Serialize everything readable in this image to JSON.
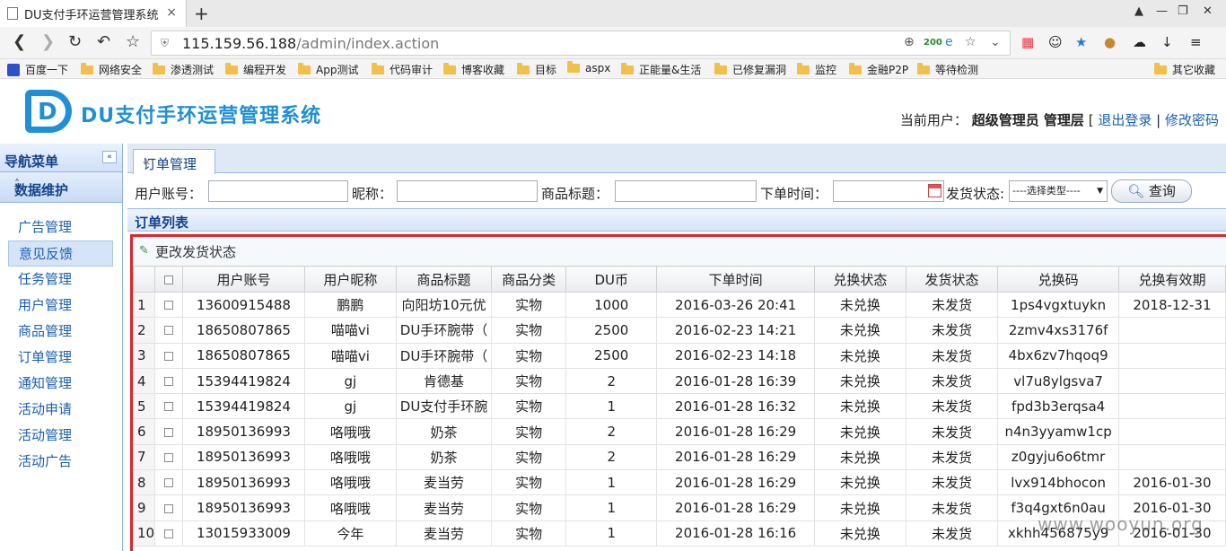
{
  "browser": {
    "tab_title": "DU支付手环运营管理系统",
    "tab_close": "×",
    "new_tab": "+",
    "url_host": "115.159.56.188",
    "url_path": "/admin/index.action",
    "badge_200": "200",
    "bookmarks": [
      "百度一下",
      "网络安全",
      "渗透测试",
      "编程开发",
      "App测试",
      "代码审计",
      "博客收藏",
      "目标",
      "aspx",
      "正能量&生活",
      "已修复漏洞",
      "监控",
      "金融P2P",
      "等待检测"
    ],
    "other_bookmarks": "其它收藏"
  },
  "header": {
    "logo_letter": "D",
    "title": "DU支付手环运营管理系统",
    "current_user_label": "当前用户：",
    "user_name": "超级管理员 管理层",
    "bracket_open": "[",
    "logout": "退出登录",
    "separator": "|",
    "change_password": "修改密码"
  },
  "sidebar": {
    "title": "导航菜单",
    "group": "数据维护",
    "items": [
      "广告管理",
      "意见反馈",
      "任务管理",
      "用户管理",
      "商品管理",
      "订单管理",
      "通知管理",
      "活动申请",
      "活动管理",
      "活动广告"
    ],
    "active_index": 1
  },
  "main": {
    "tab_label": "订单管理",
    "tab_close": "×",
    "search": {
      "account_label": "用户账号：",
      "nickname_label": "昵称：",
      "product_title_label": "商品标题：",
      "order_time_label": "下单时间：",
      "ship_status_label": "发货状态:",
      "select_value": "----选择类型----",
      "query_button": "查询"
    },
    "list_title": "订单列表",
    "toolbar_action": "更改发货状态",
    "columns": [
      "用户账号",
      "用户昵称",
      "商品标题",
      "商品分类",
      "DU币",
      "下单时间",
      "兑换状态",
      "发货状态",
      "兑换码",
      "兑换有效期"
    ],
    "rows": [
      [
        "1",
        "13600915488",
        "鹏鹏",
        "向阳坊10元优",
        "实物",
        "1000",
        "2016-03-26 20:41",
        "未兑换",
        "未发货",
        "1ps4vgxtuykn",
        "2018-12-31"
      ],
      [
        "2",
        "18650807865",
        "喵喵vi",
        "DU手环腕带（",
        "实物",
        "2500",
        "2016-02-23 14:21",
        "未兑换",
        "未发货",
        "2zmv4xs3176f",
        ""
      ],
      [
        "3",
        "18650807865",
        "喵喵vi",
        "DU手环腕带（",
        "实物",
        "2500",
        "2016-02-23 14:18",
        "未兑换",
        "未发货",
        "4bx6zv7hqoq9",
        ""
      ],
      [
        "4",
        "15394419824",
        "gj",
        "肯德基",
        "实物",
        "2",
        "2016-01-28 16:39",
        "未兑换",
        "未发货",
        "vl7u8ylgsva7",
        ""
      ],
      [
        "5",
        "15394419824",
        "gj",
        "DU支付手环腕",
        "实物",
        "1",
        "2016-01-28 16:32",
        "未兑换",
        "未发货",
        "fpd3b3erqsa4",
        ""
      ],
      [
        "6",
        "18950136993",
        "咯哦哦",
        "奶茶",
        "实物",
        "2",
        "2016-01-28 16:29",
        "未兑换",
        "未发货",
        "n4n3yyamw1cp",
        ""
      ],
      [
        "7",
        "18950136993",
        "咯哦哦",
        "奶茶",
        "实物",
        "2",
        "2016-01-28 16:29",
        "未兑换",
        "未发货",
        "z0gyju6o6tmr",
        ""
      ],
      [
        "8",
        "18950136993",
        "咯哦哦",
        "麦当劳",
        "实物",
        "1",
        "2016-01-28 16:29",
        "未兑换",
        "未发货",
        "lvx914bhocon",
        "2016-01-30"
      ],
      [
        "9",
        "18950136993",
        "咯哦哦",
        "麦当劳",
        "实物",
        "1",
        "2016-01-28 16:29",
        "未兑换",
        "未发货",
        "f3q4gxt6n0au",
        "2016-01-30"
      ],
      [
        "10",
        "13015933009",
        "今年",
        "麦当劳",
        "实物",
        "1",
        "2016-01-28 16:16",
        "未兑换",
        "未发货",
        "xkhh456875y9",
        "2016-01-30"
      ]
    ]
  },
  "watermark": "www.wooyun.org",
  "colors": {
    "accent": "#1f8fd6",
    "link": "#1a5fb4",
    "highlight_border": "#e0242b",
    "panel_header": "#15428b"
  }
}
